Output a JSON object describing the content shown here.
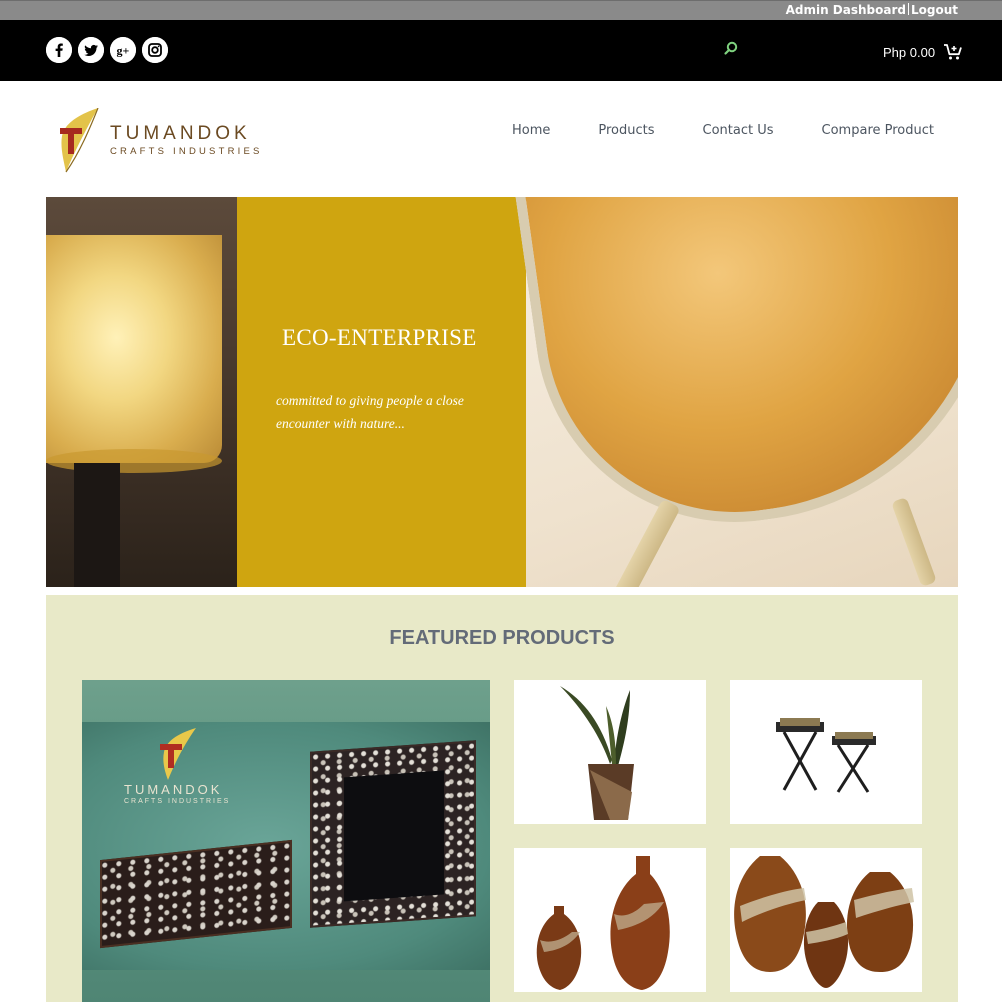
{
  "admin": {
    "dashboard_label": "Admin Dashboard",
    "logout_label": "Logout"
  },
  "topbar": {
    "social": [
      {
        "name": "facebook-icon",
        "glyph": "f"
      },
      {
        "name": "twitter-icon",
        "glyph": "t"
      },
      {
        "name": "googleplus-icon",
        "glyph": "g+"
      },
      {
        "name": "instagram-icon",
        "glyph": ""
      }
    ],
    "cart_total": "Php 0.00"
  },
  "header": {
    "brand_line1": "TUMANDOK",
    "brand_line2": "CRAFTS INDUSTRIES",
    "nav": [
      "Home",
      "Products",
      "Contact Us",
      "Compare Product"
    ]
  },
  "hero": {
    "title": "ECO-ENTERPRISE",
    "subtitle": "committed to giving people a close encounter with nature..."
  },
  "featured": {
    "title": "FEATURED PRODUCTS",
    "big_card": {
      "brand_line1": "TUMANDOK",
      "brand_line2": "CRAFTS INDUSTRIES"
    }
  },
  "colors": {
    "admin_bar": "#8a8a8a",
    "topbar": "#000000",
    "search_icon": "#7fd27f",
    "hero_mustard": "#cfa510",
    "featured_bg": "#e8e9c8",
    "featured_title": "#636b78",
    "nav_text": "#4c5560"
  }
}
